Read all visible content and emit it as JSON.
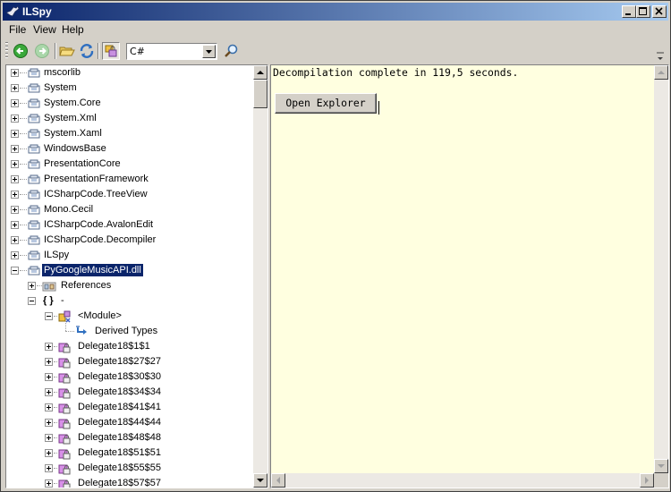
{
  "window": {
    "title": "ILSpy"
  },
  "menu": {
    "items": [
      {
        "label": "File"
      },
      {
        "label": "View"
      },
      {
        "label": "Help"
      }
    ]
  },
  "toolbar": {
    "language": "C#"
  },
  "tree": {
    "assemblies": [
      {
        "label": "mscorlib"
      },
      {
        "label": "System"
      },
      {
        "label": "System.Core"
      },
      {
        "label": "System.Xml"
      },
      {
        "label": "System.Xaml"
      },
      {
        "label": "WindowsBase"
      },
      {
        "label": "PresentationCore"
      },
      {
        "label": "PresentationFramework"
      },
      {
        "label": "ICSharpCode.TreeView"
      },
      {
        "label": "Mono.Cecil"
      },
      {
        "label": "ICSharpCode.AvalonEdit"
      },
      {
        "label": "ICSharpCode.Decompiler"
      },
      {
        "label": "ILSpy"
      },
      {
        "label": "PyGoogleMusicAPI.dll"
      }
    ],
    "references": "References",
    "namespace_braces": "{ }",
    "namespace": "-",
    "module": "<Module>",
    "derived_types": "Derived Types",
    "delegates": [
      {
        "label": "Delegate18$1$1"
      },
      {
        "label": "Delegate18$27$27"
      },
      {
        "label": "Delegate18$30$30"
      },
      {
        "label": "Delegate18$34$34"
      },
      {
        "label": "Delegate18$41$41"
      },
      {
        "label": "Delegate18$44$44"
      },
      {
        "label": "Delegate18$48$48"
      },
      {
        "label": "Delegate18$51$51"
      },
      {
        "label": "Delegate18$55$55"
      },
      {
        "label": "Delegate18$57$57"
      }
    ]
  },
  "output": {
    "message": "Decompilation complete in 119,5 seconds.",
    "open_explorer": "Open Explorer"
  },
  "colors": {
    "titlebar_start": "#0a246a",
    "titlebar_end": "#a6caf0",
    "selection": "#0a246a",
    "output_background": "#ffffe0"
  }
}
